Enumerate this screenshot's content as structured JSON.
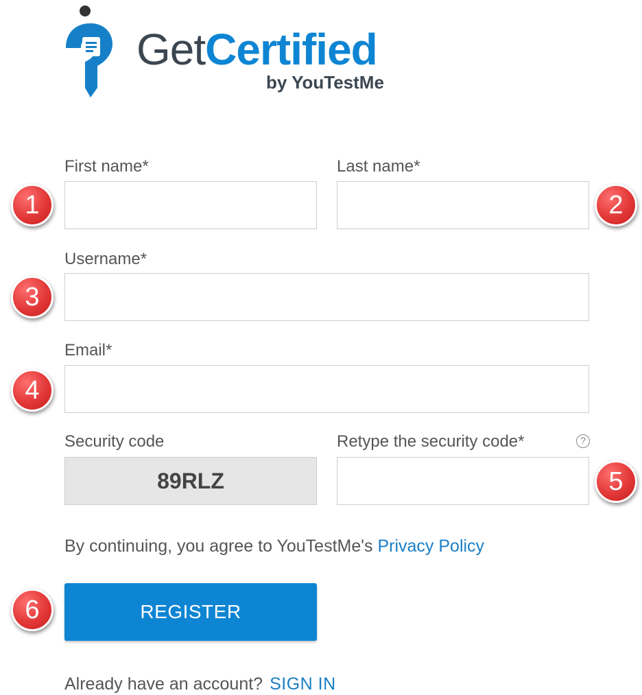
{
  "logo": {
    "get": "Get",
    "certified": "Certified",
    "by": "by YouTestMe"
  },
  "form": {
    "first_name_label": "First name*",
    "last_name_label": "Last name*",
    "username_label": "Username*",
    "email_label": "Email*",
    "security_code_label": "Security code",
    "security_code_value": "89RLZ",
    "retype_label": "Retype the security code*",
    "help_glyph": "?",
    "first_name_value": "",
    "last_name_value": "",
    "username_value": "",
    "email_value": "",
    "retype_value": ""
  },
  "consent": {
    "text": "By continuing, you agree to YouTestMe's ",
    "link": "Privacy Policy"
  },
  "register_label": "REGISTER",
  "signin": {
    "prompt": "Already have an account?",
    "link": "SIGN IN"
  },
  "badges": [
    "1",
    "2",
    "3",
    "4",
    "5",
    "6"
  ],
  "colors": {
    "brand_blue": "#0e85d3",
    "link_blue": "#1a7fc4",
    "badge_red": "#e23838"
  }
}
